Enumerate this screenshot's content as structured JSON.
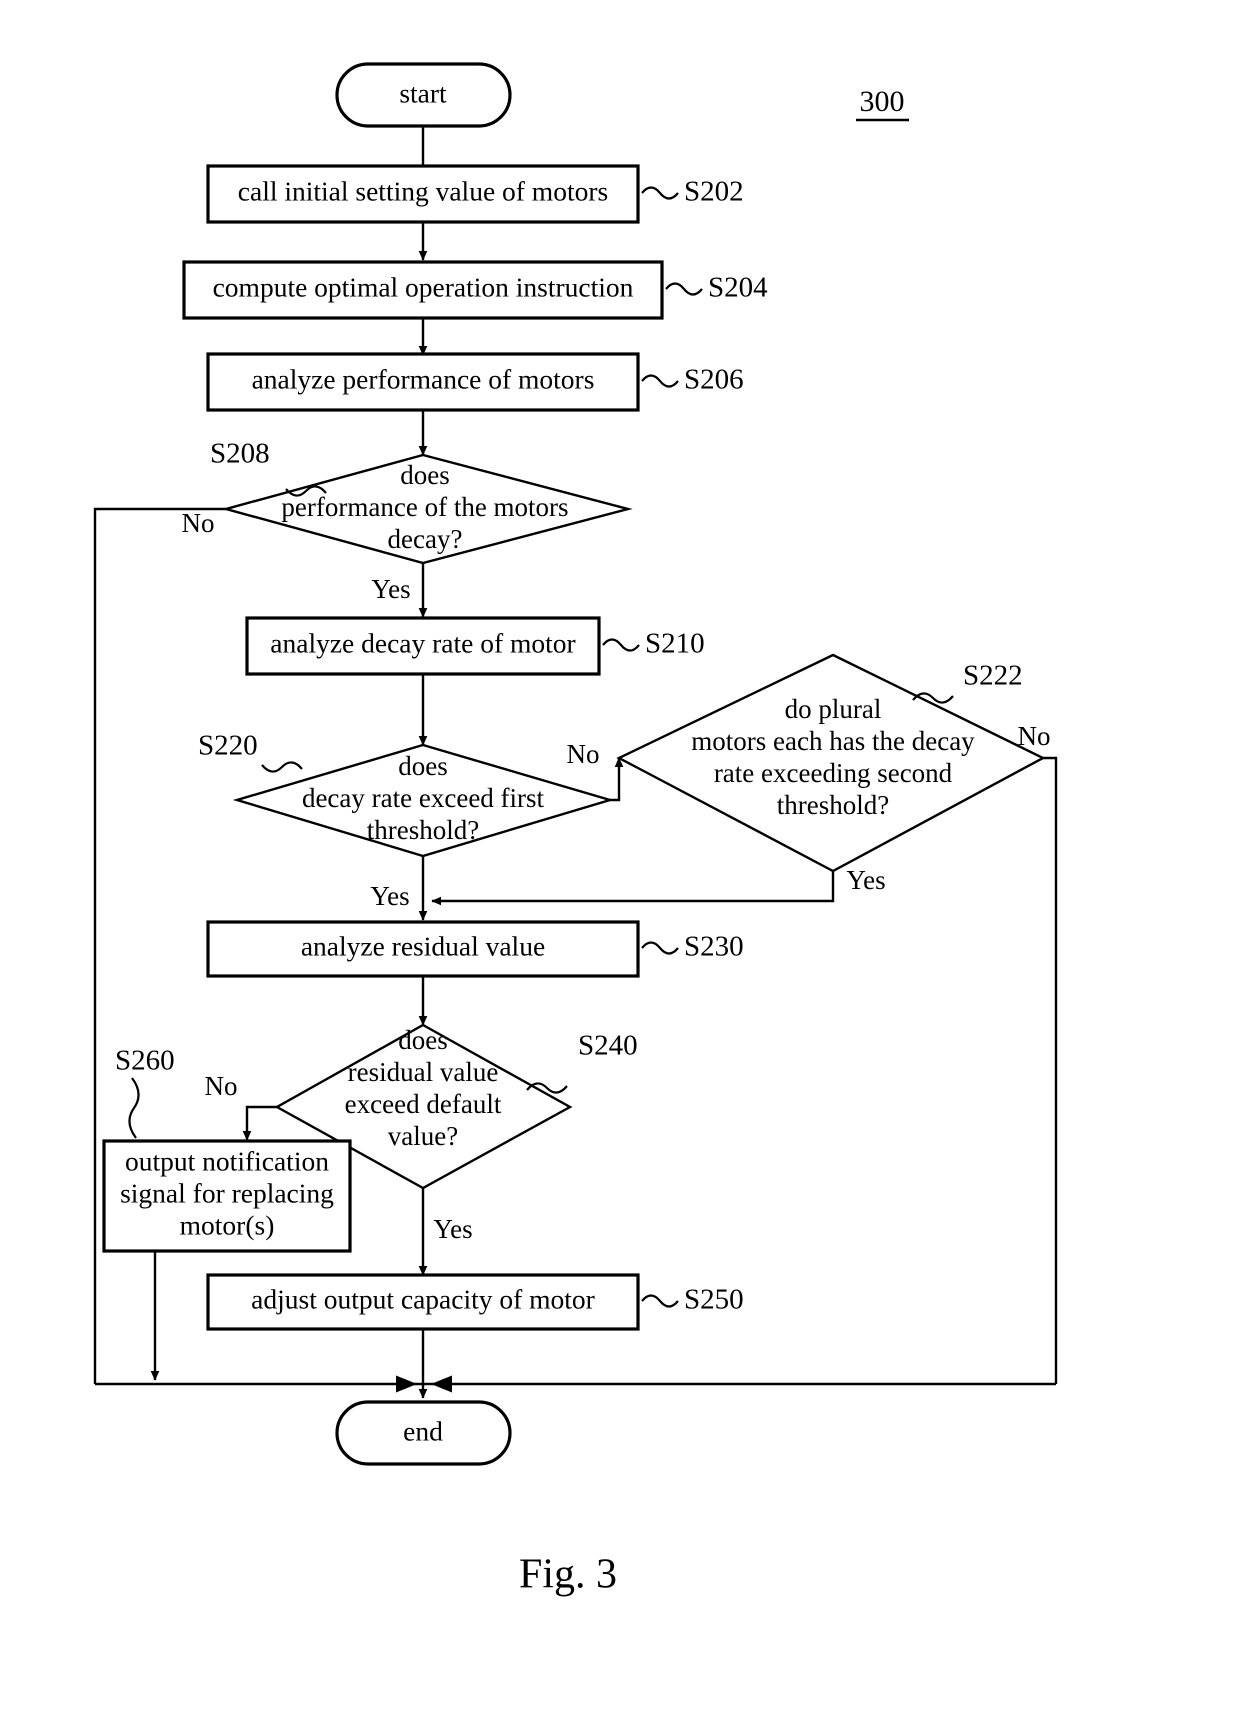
{
  "figure": {
    "caption": "Fig. 3",
    "reference_numeral": "300"
  },
  "nodes": {
    "start": {
      "label": "start",
      "type": "terminator"
    },
    "s202": {
      "label": "call initial setting value of motors",
      "ref": "S202",
      "type": "process"
    },
    "s204": {
      "label": "compute optimal operation instruction",
      "ref": "S204",
      "type": "process"
    },
    "s206": {
      "label": "analyze performance of motors",
      "ref": "S206",
      "type": "process"
    },
    "s208": {
      "ref": "S208",
      "type": "decision",
      "line1": "does",
      "line2": "performance of the motors",
      "line3": "decay?"
    },
    "s210": {
      "label": "analyze decay rate of motor",
      "ref": "S210",
      "type": "process"
    },
    "s220": {
      "ref": "S220",
      "type": "decision",
      "line1": "does",
      "line2": "decay rate exceed first",
      "line3": "threshold?"
    },
    "s222": {
      "ref": "S222",
      "type": "decision",
      "line1": "do plural",
      "line2": "motors each has the decay",
      "line3": "rate exceeding second",
      "line4": "threshold?"
    },
    "s230": {
      "label": "analyze residual value",
      "ref": "S230",
      "type": "process"
    },
    "s240": {
      "ref": "S240",
      "type": "decision",
      "line1": "does",
      "line2": "residual value",
      "line3": "exceed default",
      "line4": "value?"
    },
    "s250": {
      "label": "adjust output capacity of motor",
      "ref": "S250",
      "type": "process"
    },
    "s260": {
      "ref": "S260",
      "type": "process",
      "line1": "output notification",
      "line2": "signal for replacing",
      "line3": "motor(s)"
    },
    "end": {
      "label": "end",
      "type": "terminator"
    }
  },
  "branches": {
    "s208_no": "No",
    "s208_yes": "Yes",
    "s220_no": "No",
    "s220_yes": "Yes",
    "s222_no": "No",
    "s222_yes": "Yes",
    "s240_no": "No",
    "s240_yes": "Yes"
  },
  "colors": {
    "line": "#000000",
    "fill": "#ffffff",
    "text": "#000000"
  }
}
